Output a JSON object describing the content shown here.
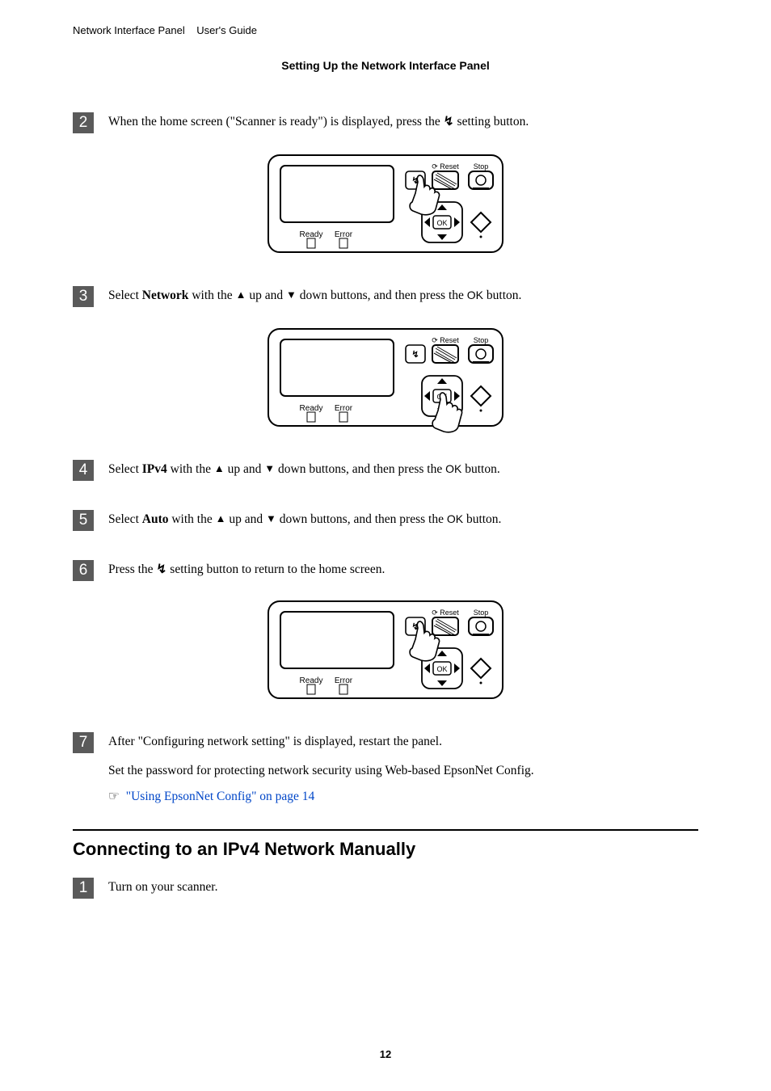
{
  "header": {
    "product": "Network Interface Panel",
    "doc_type": "User's Guide"
  },
  "section_heading": "Setting Up the Network Interface Panel",
  "steps_a": [
    {
      "num": "2",
      "text_pre": "When the home screen (\"Scanner is ready\") is displayed, press the ",
      "text_post": " setting button.",
      "has_figure": true,
      "figure_mode": "setting"
    },
    {
      "num": "3",
      "text_pre": "Select ",
      "kw": "Network",
      "text_mid": " with the ",
      "text_end": " down buttons, and then press the ",
      "ok": "OK",
      "text_post": " button.",
      "has_figure": true,
      "figure_mode": "ok"
    },
    {
      "num": "4",
      "text_pre": "Select ",
      "kw": "IPv4",
      "text_mid": " with the ",
      "text_end": " down buttons, and then press the ",
      "ok": "OK",
      "text_post": " button."
    },
    {
      "num": "5",
      "text_pre": "Select ",
      "kw": "Auto",
      "text_mid": " with the ",
      "text_end": " down buttons, and then press the ",
      "ok": "OK",
      "text_post": " button."
    },
    {
      "num": "6",
      "text_pre": "Press the ",
      "text_post": " setting button to return to the home screen.",
      "has_figure": true,
      "figure_mode": "setting"
    },
    {
      "num": "7",
      "text_pre": "After \"Configuring network setting\" is displayed, restart the panel.",
      "extra_line": "Set the password for protecting network security using Web-based EpsonNet Config.",
      "link_text": "\"Using EpsonNet Config\" on page 14"
    }
  ],
  "h2": "Connecting to an IPv4 Network Manually",
  "steps_b": [
    {
      "num": "1",
      "text": "Turn on your scanner."
    }
  ],
  "labels": {
    "up": " up and ",
    "reset": "Reset",
    "stop": "Stop",
    "ready": "Ready",
    "error": "Error",
    "ok": "OK"
  },
  "page_number": "12"
}
